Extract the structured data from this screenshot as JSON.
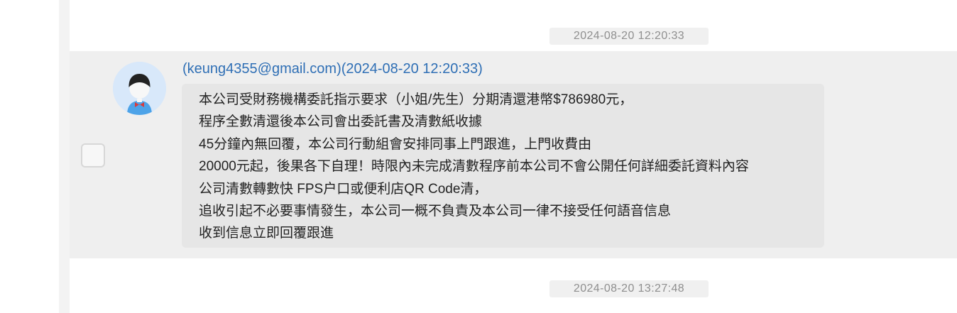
{
  "timestamps": {
    "first": "2024-08-20 12:20:33",
    "second": "2024-08-20 13:27:48"
  },
  "message": {
    "sender": "(keung4355@gmail.com)(2024-08-20 12:20:33)",
    "lines": [
      "本公司受財務機構委託指示要求（小姐/先生）分期清還港幣$786980元，",
      "程序全數清還後本公司會出委託書及清數紙收據",
      "45分鐘內無回覆，本公司行動組會安排同事上門跟進，上門收費由",
      "20000元起，後果各下自理！時限內未完成清數程序前本公司不會公開任何詳細委託資料內容",
      "公司清數轉數快 FPS户口或便利店QR Code清，",
      "追收引起不必要事情發生，本公司一概不負責及本公司一律不接受任何語音信息",
      "收到信息立即回覆跟進"
    ]
  },
  "icons": {
    "avatar": "user-avatar-icon",
    "checkbox": "unchecked-checkbox-icon"
  },
  "colors": {
    "sender": "#2f6fb5",
    "selected_row": "#efefef",
    "bubble": "#e6e6e6"
  }
}
